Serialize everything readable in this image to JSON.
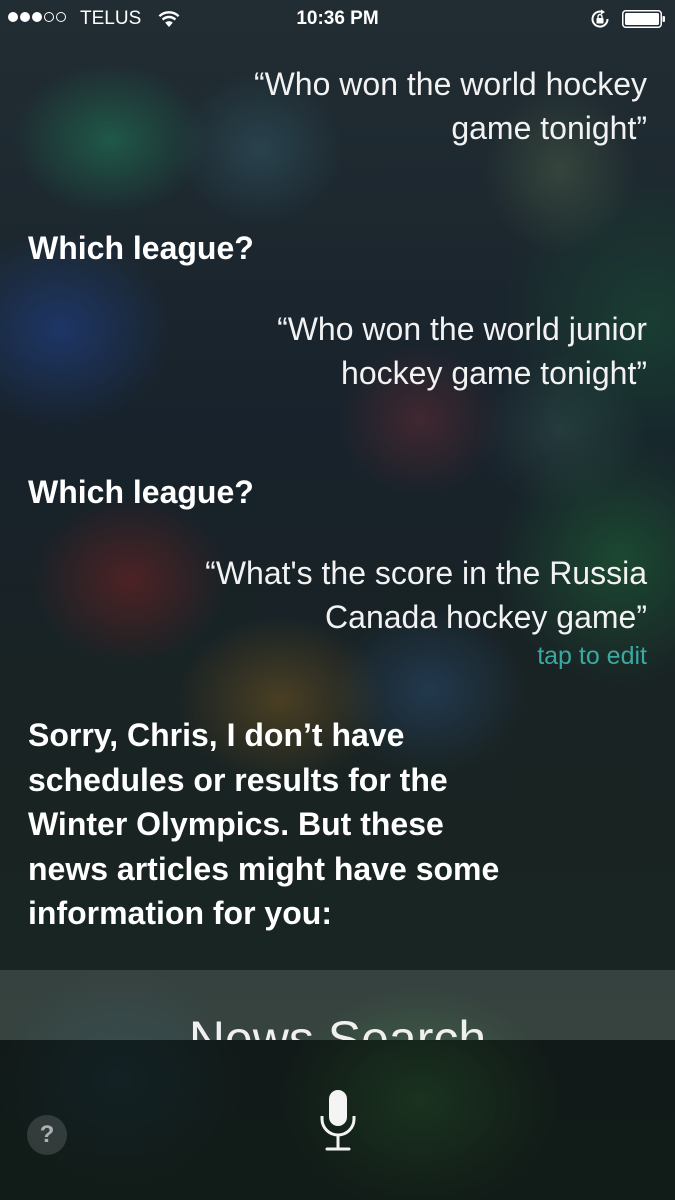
{
  "status_bar": {
    "carrier": "TELUS",
    "time": "10:36 PM",
    "signal_bars_filled": 3,
    "signal_bars_total": 5,
    "icons": [
      "wifi-icon",
      "rotation-lock-icon",
      "battery-icon"
    ]
  },
  "conversation": [
    {
      "role": "user",
      "lines": [
        "“Who won the world hockey",
        "game tonight”"
      ]
    },
    {
      "role": "siri",
      "lines": [
        "Which league?"
      ]
    },
    {
      "role": "user",
      "lines": [
        "“Who won the world junior",
        "hockey game tonight”"
      ]
    },
    {
      "role": "siri",
      "lines": [
        "Which league?"
      ]
    },
    {
      "role": "user",
      "lines": [
        "“What's the score in the Russia",
        "Canada hockey game”"
      ],
      "edit_label": "tap to edit"
    },
    {
      "role": "siri",
      "lines": [
        "Sorry, Chris, I don’t have",
        "schedules or results for the",
        "Winter Olympics. But these",
        "news articles might have some",
        "information for you:"
      ]
    }
  ],
  "news_card": {
    "title": "News Search"
  },
  "bottom_bar": {
    "help_label": "?",
    "mic_icon": "microphone-icon"
  },
  "colors": {
    "tap_to_edit": "#3aa9a0"
  }
}
